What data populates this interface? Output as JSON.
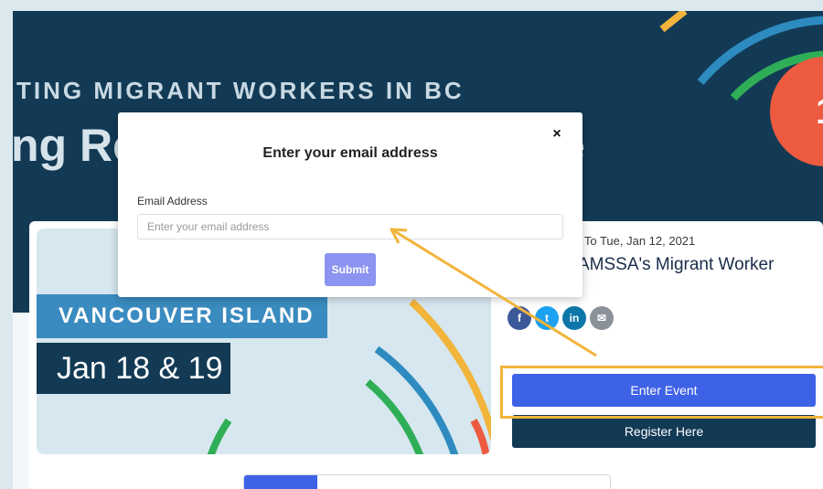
{
  "hero": {
    "subtitle": "TING MIGRANT WORKERS IN BC",
    "title_left": "ng Re",
    "title_right": "e",
    "badge_text": "1"
  },
  "event": {
    "image_location": "VANCOUVER ISLAND",
    "image_dates": "Jan 18 & 19",
    "date_range": "21 To Tue, Jan 12, 2021",
    "title": "AMSSA's Migrant Worker",
    "title_line2": "/",
    "social": [
      {
        "name": "facebook-icon",
        "glyph": "f",
        "color": "#3b5998"
      },
      {
        "name": "twitter-icon",
        "glyph": "t",
        "color": "#1da1f2"
      },
      {
        "name": "linkedin-icon",
        "glyph": "in",
        "color": "#0e76a8"
      },
      {
        "name": "email-icon",
        "glyph": "✉",
        "color": "#8a9199"
      }
    ],
    "enter_label": "Enter Event",
    "register_label": "Register Here"
  },
  "modal": {
    "title": "Enter your email address",
    "close_glyph": "×",
    "field_label": "Email Address",
    "placeholder": "Enter your email address",
    "value": "",
    "submit_label": "Submit"
  },
  "colors": {
    "hero_bg": "#123a55",
    "accent_blue": "#3e62e6",
    "submit": "#8c93f0",
    "highlight": "#f2b43a",
    "badge": "#ec5b3f"
  }
}
